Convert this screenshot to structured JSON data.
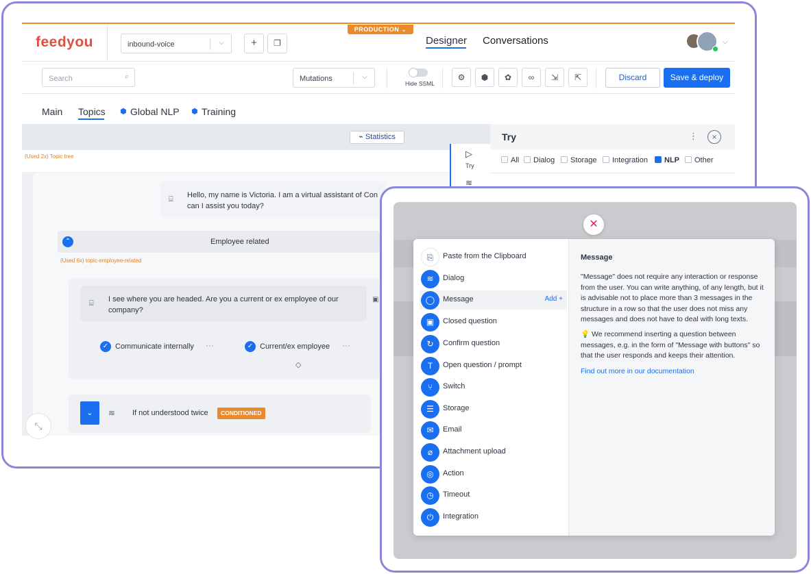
{
  "app": {
    "logo": "feedyou",
    "bot_select": "inbound-voice",
    "env_badge": "PRODUCTION",
    "nav_tabs": [
      {
        "label": "Designer",
        "active": true
      },
      {
        "label": "Conversations",
        "active": false
      }
    ]
  },
  "toolbar": {
    "search_placeholder": "Search",
    "mutations_select": "Mutations",
    "hide_ssml_label": "Hide SSML",
    "discard_label": "Discard",
    "save_label": "Save & deploy"
  },
  "subtabs": [
    {
      "label": "Main",
      "active": false
    },
    {
      "label": "Topics",
      "active": true
    },
    {
      "label": "Global NLP",
      "active": false
    },
    {
      "label": "Training",
      "active": false
    }
  ],
  "canvas": {
    "statistics_label": "Statistics",
    "topic_tree_used": "(Used 2x)",
    "topic_tree_label": "Topic tree",
    "greeting": "Hello, my name is Victoria. I am a virtual assistant of Con can I assist you today?",
    "greeting_line1": "Hello, my name is Victoria. I am a virtual assistant of Con",
    "greeting_line2": "can I assist you today?",
    "group_title": "Employee related",
    "group_used": "(Used 6x)",
    "group_id": "topic-employee-related",
    "question_line1": "I see where you are headed. Are you a current or ex employee of our",
    "question_line2": "company?",
    "chips": [
      "Communicate internally",
      "Current/ex employee"
    ],
    "fallback_title": "If not understood twice",
    "fallback_badge": "CONDITIONED",
    "side_try_label": "Try"
  },
  "try_panel": {
    "title": "Try",
    "filters": [
      {
        "label": "All",
        "checked": false
      },
      {
        "label": "Dialog",
        "checked": false
      },
      {
        "label": "Storage",
        "checked": false
      },
      {
        "label": "Integration",
        "checked": false
      },
      {
        "label": "NLP",
        "checked": true
      },
      {
        "label": "Other",
        "checked": false
      }
    ]
  },
  "modal": {
    "items": [
      {
        "label": "Paste from the Clipboard",
        "icon": "clipboard-icon",
        "glyph": "⎘"
      },
      {
        "label": "Dialog",
        "icon": "layers-icon",
        "glyph": "≋"
      },
      {
        "label": "Message",
        "icon": "chat-bubble-icon",
        "glyph": "◯",
        "selected": true
      },
      {
        "label": "Closed question",
        "icon": "closed-question-icon",
        "glyph": "▣"
      },
      {
        "label": "Confirm question",
        "icon": "confirm-icon",
        "glyph": "↻"
      },
      {
        "label": "Open question / prompt",
        "icon": "text-cursor-icon",
        "glyph": "T"
      },
      {
        "label": "Switch",
        "icon": "switch-icon",
        "glyph": "⑂"
      },
      {
        "label": "Storage",
        "icon": "database-icon",
        "glyph": "☰"
      },
      {
        "label": "Email",
        "icon": "email-icon",
        "glyph": "✉"
      },
      {
        "label": "Attachment upload",
        "icon": "paperclip-icon",
        "glyph": "⌀"
      },
      {
        "label": "Action",
        "icon": "action-icon",
        "glyph": "◎"
      },
      {
        "label": "Timeout",
        "icon": "stopwatch-icon",
        "glyph": "◷"
      },
      {
        "label": "Integration",
        "icon": "plug-icon",
        "glyph": "⏻"
      }
    ],
    "add_label": "Add",
    "detail_title": "Message",
    "detail_text_1": "\"Message\" does not require any interaction or response from the user. You can write anything, of any length, but it is advisable not to place more than 3 messages in the structure in a row so that the user does not miss any messages and does not have to deal with long texts.",
    "detail_text_2": "We recommend inserting a question between messages, e.g. in the form of \"Message with buttons\" so that the user responds and keeps their attention.",
    "detail_link": "Find out more in our documentation"
  },
  "colors": {
    "accent": "#1a6ff0",
    "brand": "#e0503f",
    "production": "#e88b2d",
    "frame": "#8a86d8"
  }
}
